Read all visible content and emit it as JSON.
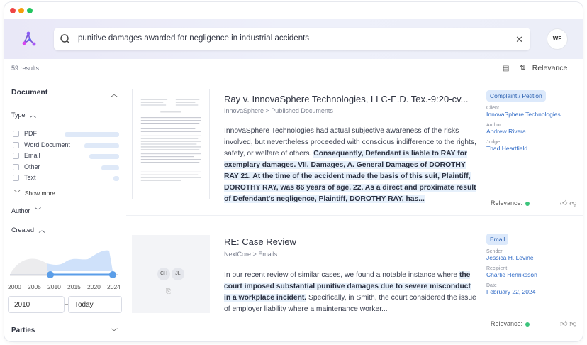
{
  "window": {
    "controls": [
      "close",
      "minimize",
      "maximize"
    ]
  },
  "header": {
    "search_query": "punitive damages awarded for negligence in industrial accidents",
    "avatar_initials": "WF"
  },
  "toolbar": {
    "results_count": "59 results",
    "sort_label": "Relevance"
  },
  "filters": {
    "document_heading": "Document",
    "type_heading": "Type",
    "types": [
      {
        "label": "PDF",
        "share": 0.55
      },
      {
        "label": "Word Document",
        "share": 0.35
      },
      {
        "label": "Email",
        "share": 0.3
      },
      {
        "label": "Other",
        "share": 0.18
      },
      {
        "label": "Text",
        "share": 0.06
      }
    ],
    "show_more": "Show more",
    "author_heading": "Author",
    "created_heading": "Created",
    "year_ticks": [
      "2000",
      "2005",
      "2010",
      "2015",
      "2020",
      "2024"
    ],
    "range_start_label": "2010",
    "range_end_label": "2024",
    "date_from": "2010",
    "date_to": "Today",
    "parties_heading": "Parties"
  },
  "results": [
    {
      "title": "Ray v. InnovaSphere Technologies, LLC-E.D. Tex.-9:20-cv...",
      "path": "InnovaSphere > Published Documents",
      "snippet_plain": "InnovaSphere Technologies had actual subjective awareness of the risks involved, but nevertheless proceeded with conscious indifference to the rights, safety, or welfare of others. ",
      "snippet_highlight": "Consequently, Defendant is liable to RAY for exemplary damages. VII. Damages, A. General Damages of DOROTHY RAY 21.  At the time of the accident made the basis of this suit, Plaintiff, DOROTHY RAY, was 86 years of age. 22. As a direct and proximate result of Defendant's negligence, Plaintiff, DOROTHY RAY, has...",
      "badge": "Complaint / Petition",
      "meta": [
        {
          "key": "Client",
          "value": "InnovaSphere Technologies"
        },
        {
          "key": "Author",
          "value": "Andrew Rivera"
        },
        {
          "key": "Judge",
          "value": "Thad Heartfield"
        }
      ],
      "relevance_label": "Relevance:"
    },
    {
      "title": "RE: Case Review",
      "path": "NextCore > Emails",
      "snippet_plain": "In our recent review of similar cases, we found a notable instance where ",
      "snippet_highlight": "the court imposed substantial punitive damages due to severe misconduct in a workplace incident.",
      "snippet_tail": " Specifically, in Smith, the court considered the issue of employer liability where a maintenance worker...",
      "badge": "Email",
      "initials": [
        "CH",
        "JL"
      ],
      "meta": [
        {
          "key": "Sender",
          "value": "Jessica H. Levine"
        },
        {
          "key": "Recipient",
          "value": "Charlie Henriksson"
        },
        {
          "key": "Date",
          "value": "February 22, 2024"
        }
      ],
      "relevance_label": "Relevance:"
    }
  ],
  "colors": {
    "accent": "#2f6ac6",
    "badge_bg": "#dce9fb",
    "highlight_bg": "#e6f0fb",
    "relevance": "#3cc47c"
  }
}
